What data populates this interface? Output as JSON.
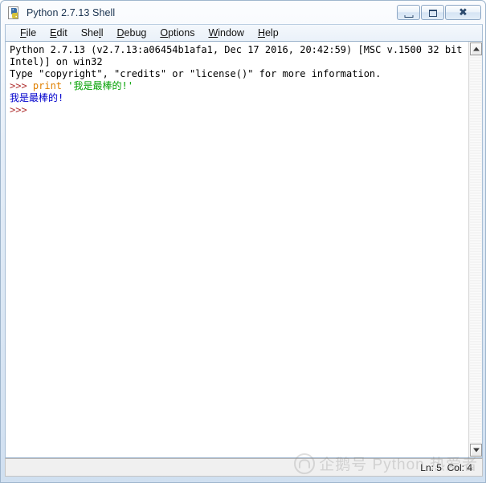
{
  "window": {
    "title": "Python 2.7.13 Shell",
    "icon": "python-idle-icon",
    "caption": {
      "minimize_label": "Minimize",
      "maximize_label": "Maximize",
      "close_label": "Close"
    }
  },
  "menubar": {
    "items": [
      {
        "label": "File",
        "accel": "F"
      },
      {
        "label": "Edit",
        "accel": "E"
      },
      {
        "label": "Shell",
        "accel": "l"
      },
      {
        "label": "Debug",
        "accel": "D"
      },
      {
        "label": "Options",
        "accel": "O"
      },
      {
        "label": "Window",
        "accel": "W"
      },
      {
        "label": "Help",
        "accel": "H"
      }
    ]
  },
  "console": {
    "lines": [
      {
        "type": "plain",
        "text": "Python 2.7.13 (v2.7.13:a06454b1afa1, Dec 17 2016, 20:42:59) [MSC v.1500 32 bit ("
      },
      {
        "type": "plain",
        "text": "Intel)] on win32"
      },
      {
        "type": "plain",
        "text": "Type \"copyright\", \"credits\" or \"license()\" for more information."
      },
      {
        "type": "input",
        "prompt": ">>> ",
        "keyword": "print",
        "space": " ",
        "string": "'我是最棒的!'"
      },
      {
        "type": "output",
        "text": "我是最棒的!"
      },
      {
        "type": "prompt",
        "text": ">>>"
      }
    ]
  },
  "scrollbar": {
    "up_arrow": "scroll-up",
    "down_arrow": "scroll-down"
  },
  "statusbar": {
    "position": "Ln: 5  Col: 4"
  },
  "watermark": {
    "text": "企鹅号 Python 热爱者"
  },
  "colors": {
    "prompt": "#b03030",
    "keyword": "#e08000",
    "string": "#00a000",
    "output": "#0000cc",
    "text": "#000000",
    "console_bg": "#ffffff"
  }
}
